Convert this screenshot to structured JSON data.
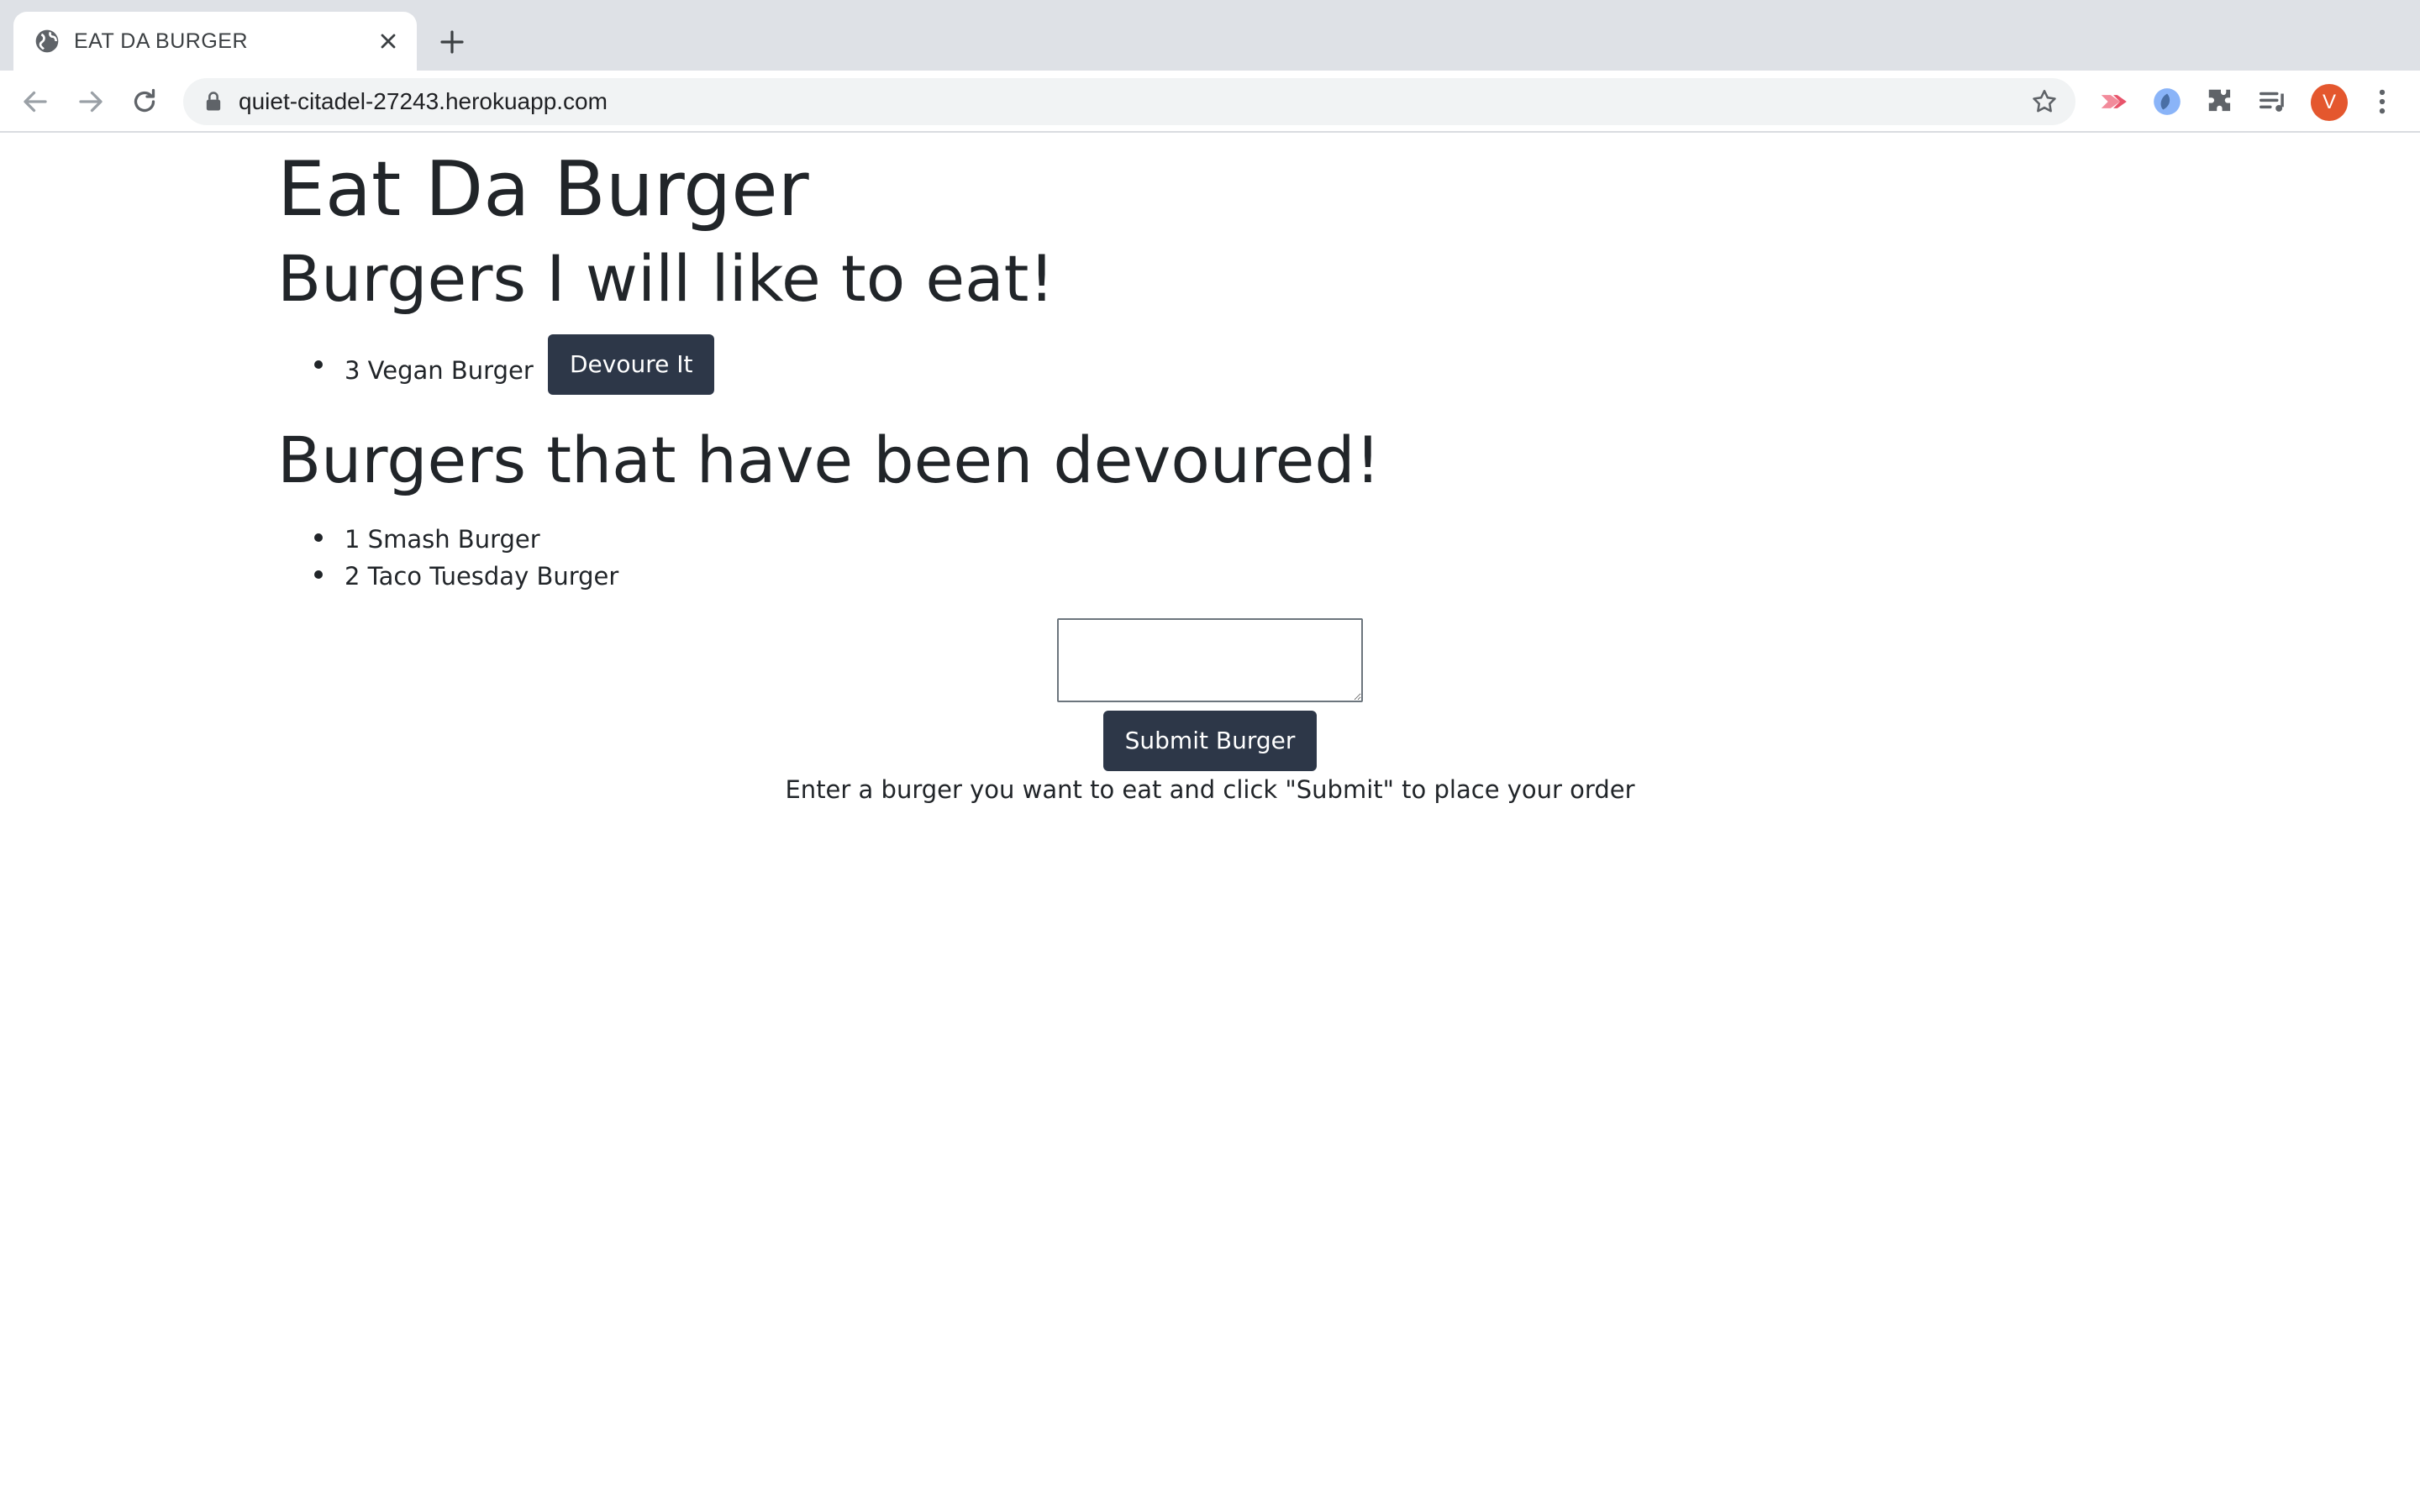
{
  "browser": {
    "tab": {
      "title": "EAT DA BURGER"
    },
    "address_bar": {
      "url": "quiet-citadel-27243.herokuapp.com"
    },
    "profile": {
      "initial": "V",
      "color": "#e4572e"
    },
    "icons": [
      "globe-icon",
      "close-icon",
      "plus-icon",
      "back-arrow-icon",
      "forward-arrow-icon",
      "reload-icon",
      "lock-icon",
      "star-icon",
      "cast-extension-icon",
      "extension-icon",
      "puzzle-icon",
      "media-queue-icon",
      "kebab-menu-icon"
    ]
  },
  "page": {
    "title": "Eat Da Burger",
    "to_eat": {
      "heading": "Burgers I will like to eat!",
      "items": [
        {
          "label": "3 Vegan Burger",
          "button": "Devoure It"
        }
      ]
    },
    "devoured": {
      "heading": "Burgers that have been devoured!",
      "items": [
        {
          "label": "1 Smash Burger"
        },
        {
          "label": "2 Taco Tuesday Burger"
        }
      ]
    },
    "form": {
      "textarea_value": "",
      "submit_label": "Submit Burger",
      "helper": "Enter a burger you want to eat and click \"Submit\" to place your order"
    }
  },
  "colors": {
    "button_bg": "#2d3748",
    "text": "#212529",
    "tabstrip_bg": "#dee1e6"
  }
}
